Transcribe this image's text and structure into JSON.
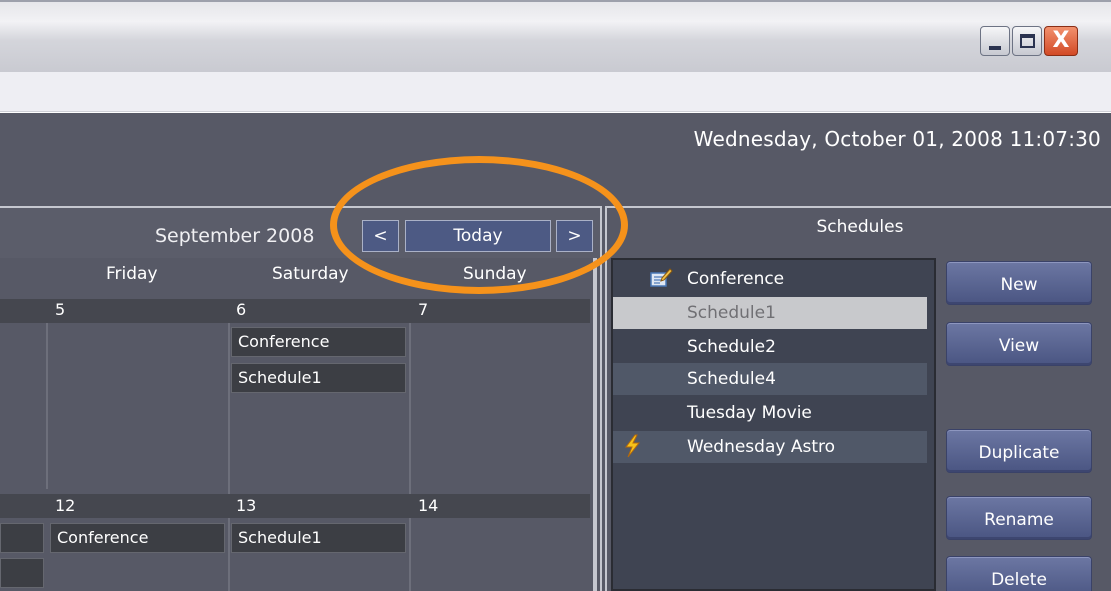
{
  "window": {
    "controls": {
      "minimize": "_",
      "maximize": "□",
      "close": "X"
    }
  },
  "header": {
    "datetime": "Wednesday, October 01, 2008 11:07:30"
  },
  "calendar": {
    "month_label": "September 2008",
    "nav": {
      "prev": "<",
      "today": "Today",
      "next": ">"
    },
    "day_names": [
      "Friday",
      "Saturday",
      "Sunday"
    ],
    "weeks": [
      {
        "days": [
          "5",
          "6",
          "7"
        ],
        "events": {
          "saturday": [
            "Conference",
            "Schedule1"
          ]
        }
      },
      {
        "days": [
          "12",
          "13",
          "14"
        ],
        "events": {
          "friday": [
            "Conference"
          ],
          "saturday": [
            "Schedule1"
          ]
        }
      }
    ]
  },
  "schedules": {
    "title": "Schedules",
    "items": [
      {
        "label": "Conference",
        "icon": "edit-icon"
      },
      {
        "label": "Schedule1",
        "state": "selected"
      },
      {
        "label": "Schedule2"
      },
      {
        "label": "Schedule4",
        "state": "highlighted"
      },
      {
        "label": "Tuesday Movie"
      },
      {
        "label": "Wednesday Astro",
        "icon": "lightning-icon",
        "state": "highlighted"
      }
    ],
    "buttons": {
      "new": "New",
      "view": "View",
      "duplicate": "Duplicate",
      "rename": "Rename",
      "delete": "Delete"
    }
  },
  "colors": {
    "annotation": "#f5921b",
    "app_background": "#575966",
    "button": "#5a6591"
  }
}
